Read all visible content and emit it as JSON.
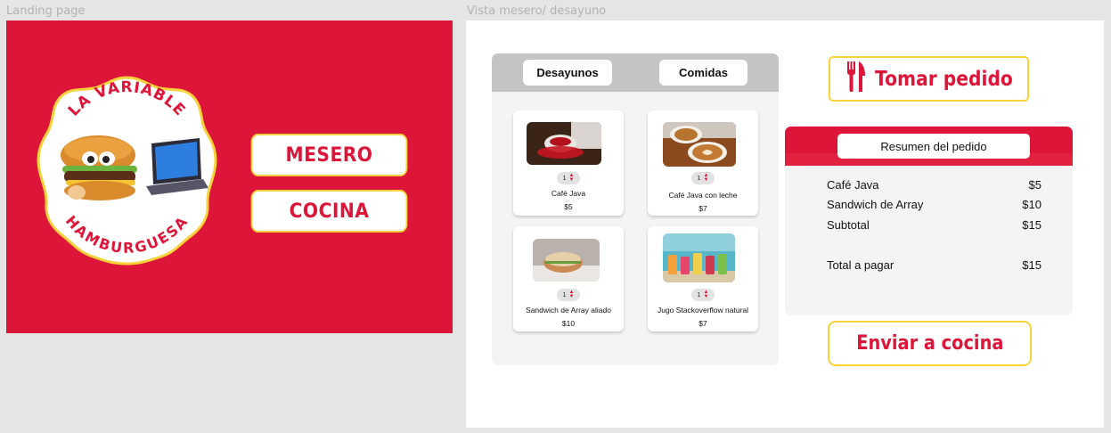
{
  "frames": {
    "landing_label": "Landing page",
    "mesero_label": "Vista mesero/ desayuno"
  },
  "landing": {
    "logo_text_top": "LA VARIABLE",
    "logo_text_bottom": "HAMBURGUESA",
    "mesero_button": "MESERO",
    "cocina_button": "COCINA"
  },
  "menu": {
    "tabs": [
      {
        "label": "Desayunos"
      },
      {
        "label": "Comidas"
      }
    ],
    "items": [
      {
        "name": "Café Java",
        "price": "$5",
        "qty": "1",
        "image": "coffee-cup-photo"
      },
      {
        "name": "Café Java con leche",
        "price": "$7",
        "qty": "1",
        "image": "latte-art-photo"
      },
      {
        "name": "Sandwich de Array aliado",
        "price": "$10",
        "qty": "1",
        "image": "sandwich-photo"
      },
      {
        "name": "Jugo Stackoverflow natural",
        "price": "$7",
        "qty": "1",
        "image": "juice-photo"
      }
    ]
  },
  "actions": {
    "take_order": "Tomar pedido",
    "send_kitchen": "Enviar a cocina"
  },
  "summary": {
    "title": "Resumen del pedido",
    "rows": [
      {
        "label": "Café Java",
        "value": "$5"
      },
      {
        "label": "Sandwich de Array",
        "value": "$10"
      },
      {
        "label": "Subtotal",
        "value": "$15"
      }
    ],
    "total_label": "Total a pagar",
    "total_value": "$15"
  },
  "colors": {
    "brand_red": "#dc1539",
    "accent_yellow": "#f7d23a",
    "tab_bar_gray": "#c4c4c4"
  },
  "icons": [
    "fork-knife-icon",
    "stepper-arrows-icon",
    "burger-mascot-logo"
  ]
}
